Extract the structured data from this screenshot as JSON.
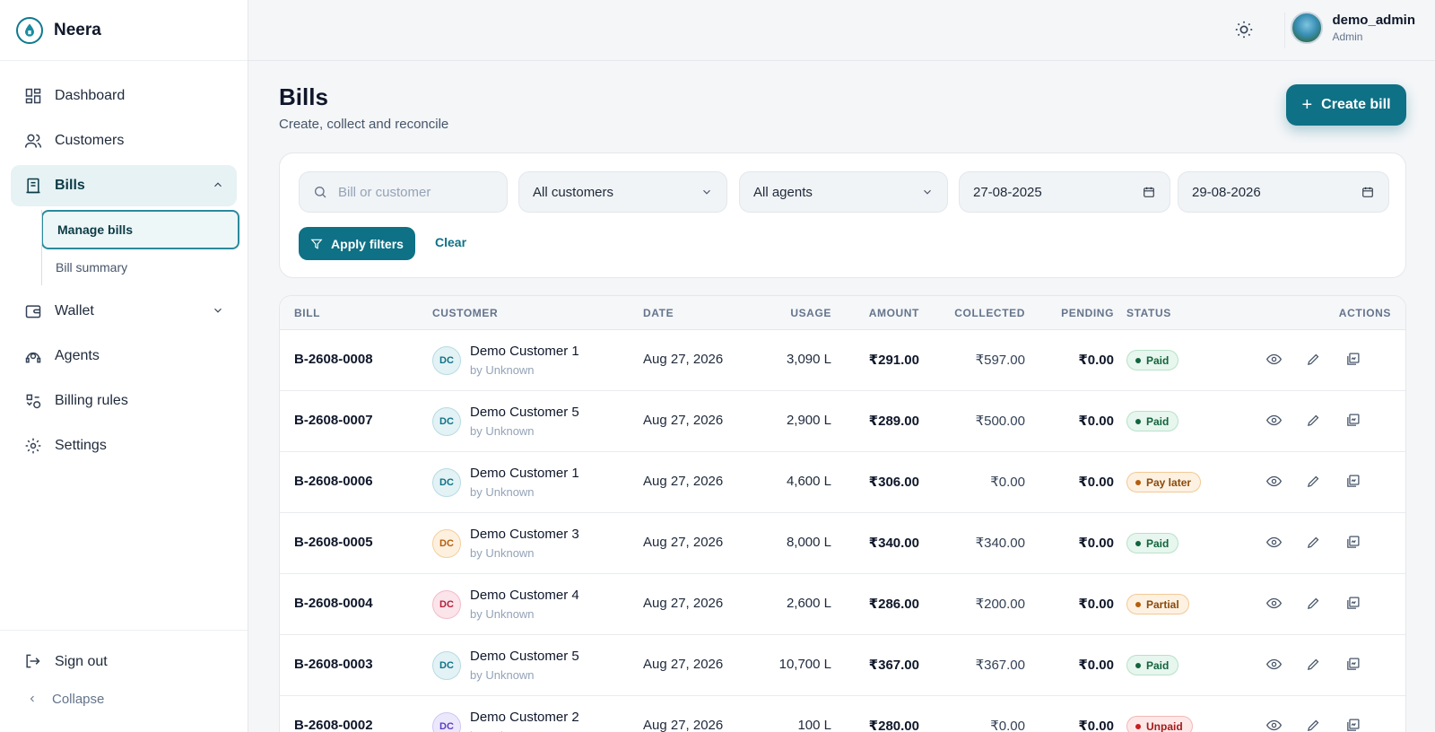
{
  "app": {
    "name": "Neera"
  },
  "sidebar": {
    "items": [
      {
        "label": "Dashboard",
        "icon": "dashboard-icon"
      },
      {
        "label": "Customers",
        "icon": "users-icon"
      },
      {
        "label": "Bills",
        "icon": "bill-icon",
        "active": true,
        "expanded": true
      },
      {
        "label": "Wallet",
        "icon": "wallet-icon"
      },
      {
        "label": "Agents",
        "icon": "agent-icon"
      },
      {
        "label": "Billing rules",
        "icon": "rules-icon"
      },
      {
        "label": "Settings",
        "icon": "gear-icon"
      }
    ],
    "bills_sub": [
      {
        "label": "Manage bills",
        "active": true
      },
      {
        "label": "Bill summary"
      }
    ],
    "sign_out": "Sign out",
    "collapse": "Collapse"
  },
  "header": {
    "user_name": "demo_admin",
    "user_role": "Admin"
  },
  "page": {
    "title": "Bills",
    "subtitle": "Create, collect and reconcile",
    "create_label": "Create bill"
  },
  "filters": {
    "search_placeholder": "Bill or customer",
    "customer": "All customers",
    "agent": "All agents",
    "date_from": "27-08-2025",
    "date_to": "29-08-2026",
    "apply_label": "Apply filters",
    "clear_label": "Clear"
  },
  "table": {
    "columns": [
      "BILL",
      "CUSTOMER",
      "DATE",
      "USAGE",
      "AMOUNT",
      "COLLECTED",
      "PENDING",
      "STATUS",
      "ACTIONS"
    ],
    "rows": [
      {
        "bill": "B-2608-0008",
        "initials": "DC",
        "customer": "Demo Customer 1",
        "by": "by Unknown",
        "date": "Aug 27, 2026",
        "usage": "3,090 L",
        "amount": "₹291.00",
        "collected": "₹597.00",
        "pending": "₹0.00",
        "status": "Paid"
      },
      {
        "bill": "B-2608-0007",
        "initials": "DC",
        "customer": "Demo Customer 5",
        "by": "by Unknown",
        "date": "Aug 27, 2026",
        "usage": "2,900 L",
        "amount": "₹289.00",
        "collected": "₹500.00",
        "pending": "₹0.00",
        "status": "Paid"
      },
      {
        "bill": "B-2608-0006",
        "initials": "DC",
        "customer": "Demo Customer 1",
        "by": "by Unknown",
        "date": "Aug 27, 2026",
        "usage": "4,600 L",
        "amount": "₹306.00",
        "collected": "₹0.00",
        "pending": "₹0.00",
        "status": "Pay later"
      },
      {
        "bill": "B-2608-0005",
        "initials": "DC",
        "customer": "Demo Customer 3",
        "by": "by Unknown",
        "date": "Aug 27, 2026",
        "usage": "8,000 L",
        "amount": "₹340.00",
        "collected": "₹340.00",
        "pending": "₹0.00",
        "status": "Paid"
      },
      {
        "bill": "B-2608-0004",
        "initials": "DC",
        "customer": "Demo Customer 4",
        "by": "by Unknown",
        "date": "Aug 27, 2026",
        "usage": "2,600 L",
        "amount": "₹286.00",
        "collected": "₹200.00",
        "pending": "₹0.00",
        "status": "Partial"
      },
      {
        "bill": "B-2608-0003",
        "initials": "DC",
        "customer": "Demo Customer 5",
        "by": "by Unknown",
        "date": "Aug 27, 2026",
        "usage": "10,700 L",
        "amount": "₹367.00",
        "collected": "₹367.00",
        "pending": "₹0.00",
        "status": "Paid"
      },
      {
        "bill": "B-2608-0002",
        "initials": "DC",
        "customer": "Demo Customer 2",
        "by": "by Unknown",
        "date": "Aug 27, 2026",
        "usage": "100 L",
        "amount": "₹280.00",
        "collected": "₹0.00",
        "pending": "₹0.00",
        "status": "Unpaid"
      }
    ]
  },
  "colors": {
    "accent": "#0e7186",
    "active_bg": "#e6f2f4",
    "paid": "#12643c",
    "pay_later": "#b45f0e",
    "unpaid": "#c81e1e"
  }
}
